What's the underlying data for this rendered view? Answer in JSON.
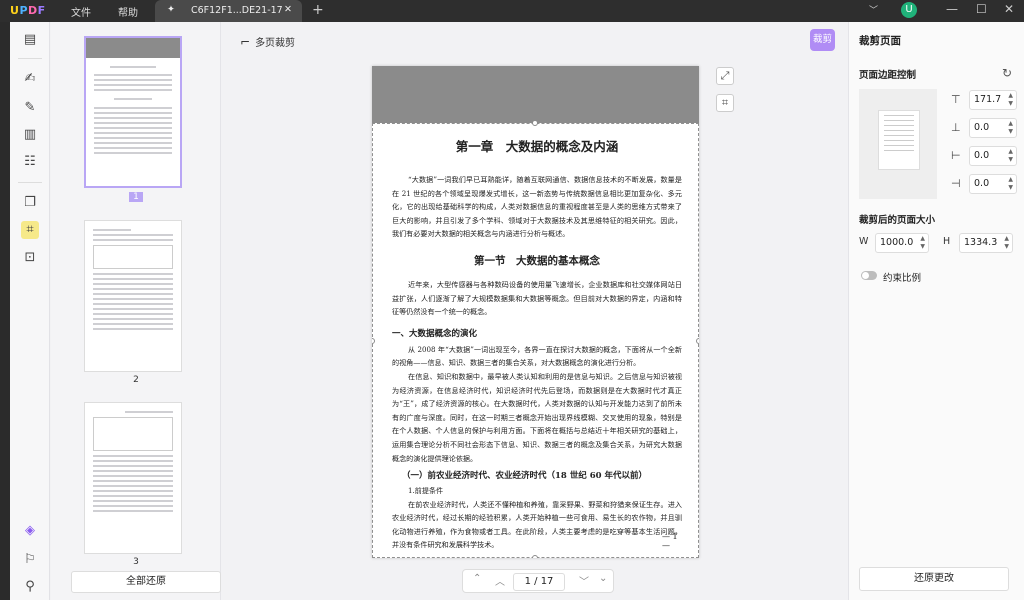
{
  "app": {
    "logo": "UPDF",
    "menu": [
      "文件",
      "帮助"
    ],
    "tab_title": "C6F12F1...DE21-17",
    "new_tab": "+",
    "user_initial": "U"
  },
  "thumbnails": {
    "pages": [
      "1",
      "2",
      "3"
    ],
    "restore_all": "全部还原"
  },
  "canvas": {
    "multi_page_crop": "多页裁剪",
    "crop_button": "裁剪",
    "page_current": "1",
    "page_total": "17",
    "document": {
      "chapter_title": "第一章　大数据的概念及内涵",
      "para1": "“大数据”一词我们早已耳熟能详，随着互联网通信、数据信息技术的不断发展，数量是在 21 世纪的各个领域呈现爆发式增长，这一新态势与传统数据信息相比更加复杂化、多元化，它的出现给基础科学的构成，人类对数据信息的重视程度甚至是人类的思维方式带来了巨大的影响，并且引发了多个学科、领域对于大数据技术及其思维特征的相关研究。因此，我们有必要对大数据的相关概念与内涵进行分析与概述。",
      "section_title": "第一节　大数据的基本概念",
      "para2": "近年来，大型传感器与各种数码设备的使用量飞速增长，企业数据库和社交媒体网站日益扩张，人们逐渐了解了大规模数据集和大数据等概念。但目前对大数据的界定，内涵和特征等仍然没有一个统一的概念。",
      "sub1": "一、大数据概念的演化",
      "para3": "从 2008 年“大数据”一词出现至今，各界一直在探讨大数据的概念，下面将从一个全新的视角——信息、知识、数据三者的集合关系，对大数据概念的演化进行分析。",
      "para4": "在信息、知识和数据中，最早被人类认知和利用的是信息与知识。之后信息与知识被视为经济资源，在信息经济时代，知识经济时代先后登场，而数据则是在大数据时代才真正为“王”，成了经济资源的核心。在大数据时代，人类对数据的认知与开发能力达到了前所未有的广度与深度。同时，在这一时期三者概念开始出现界线模糊、交叉使用的现象，特别是在个人数据、个人信息的保护与利用方面。下面将在概括与总结近十年相关研究的基础上，运用集合理论分析不同社会形态下信息、知识、数据三者的概念及集合关系，为研究大数据概念的演化提供理论依据。",
      "sub2": "（一）前农业经济时代、农业经济时代（18 世纪 60 年代以前）",
      "sub3": "1.前提条件",
      "para5": "在前农业经济时代，人类还不懂种植和养殖，靠采野果、野菜和狩猎来保证生存。进入农业经济时代，经过长期的经验积累，人类开始种植一些可食用、易生长的农作物，并且驯化动物进行养殖，作为食物或者工具。在此阶段，人类主要考虑的是吃穿等基本生活问题，并没有条件研究和发展科学技术。",
      "page_footer": "— 1 —"
    }
  },
  "crop_panel": {
    "title": "裁剪页面",
    "margin_control": "页面边距控制",
    "margins": [
      "171.7",
      "0.0",
      "0.0",
      "0.0"
    ],
    "size_after": "裁剪后的页面大小",
    "width_label": "W",
    "width": "1000.0",
    "height_label": "H",
    "height": "1334.3",
    "constrain": "约束比例",
    "restore_changes": "还原更改"
  },
  "colors": {
    "accent": "#b08cf5",
    "active_tool": "#f6e98a",
    "avatar": "#20b27a"
  },
  "icons": {
    "tools": [
      "reader-icon",
      "comment-icon",
      "edit-icon",
      "page-icon",
      "form-icon",
      "organize-icon",
      "crop-icon",
      "redact-icon",
      "layers-icon",
      "bookmark-icon",
      "attachment-icon"
    ]
  }
}
